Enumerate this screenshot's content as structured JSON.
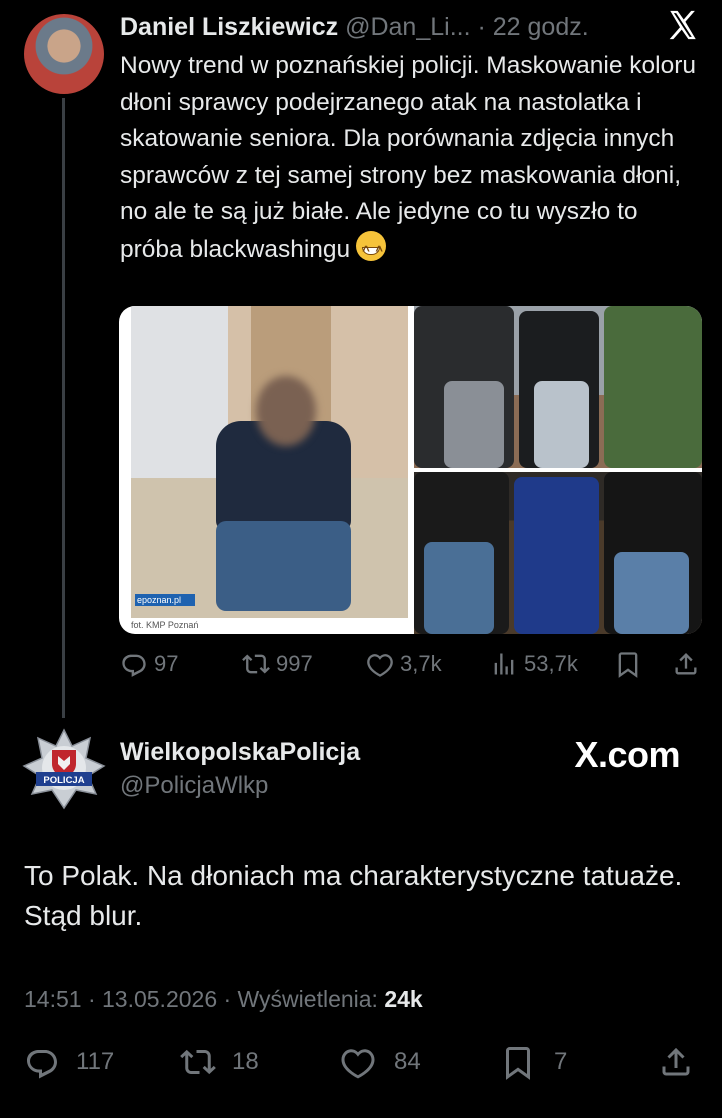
{
  "tweet1": {
    "display_name": "Daniel Liszkiewicz",
    "handle": "@Dan_Li...",
    "time": "· 22 godz.",
    "text": "Nowy trend w poznańskiej policji. Maskowanie koloru dłoni sprawcy podejrzanego atak na nastolatka i skatowanie seniora. Dla porównania zdjęcia innych sprawców z tej samej strony bez maskowania dłoni, no ale te są już białe. Ale jedyne co tu wyszło to próba blackwashingu",
    "media": {
      "badge": "epoznan.pl",
      "caption": "fot. KMP Poznań"
    },
    "stats": {
      "replies": "97",
      "reposts": "997",
      "likes": "3,7k",
      "views": "53,7k"
    }
  },
  "tweet2": {
    "display_name": "WielkopolskaPolicja",
    "handle": "@PolicjaWlkp",
    "avatar_label": "POLICJA",
    "text": "To Polak. Na dłoniach ma charakterystyczne tatuaże. Stąd blur.",
    "meta_prefix": "14:51 · 13.05.2026 · Wyświetlenia: ",
    "views": "24k",
    "stats": {
      "replies": "117",
      "reposts": "18",
      "likes": "84",
      "bookmarks": "7"
    }
  },
  "watermark": "X.com",
  "colors": {
    "background": "#000000",
    "text": "#e7e9ea",
    "muted": "#71767b"
  }
}
